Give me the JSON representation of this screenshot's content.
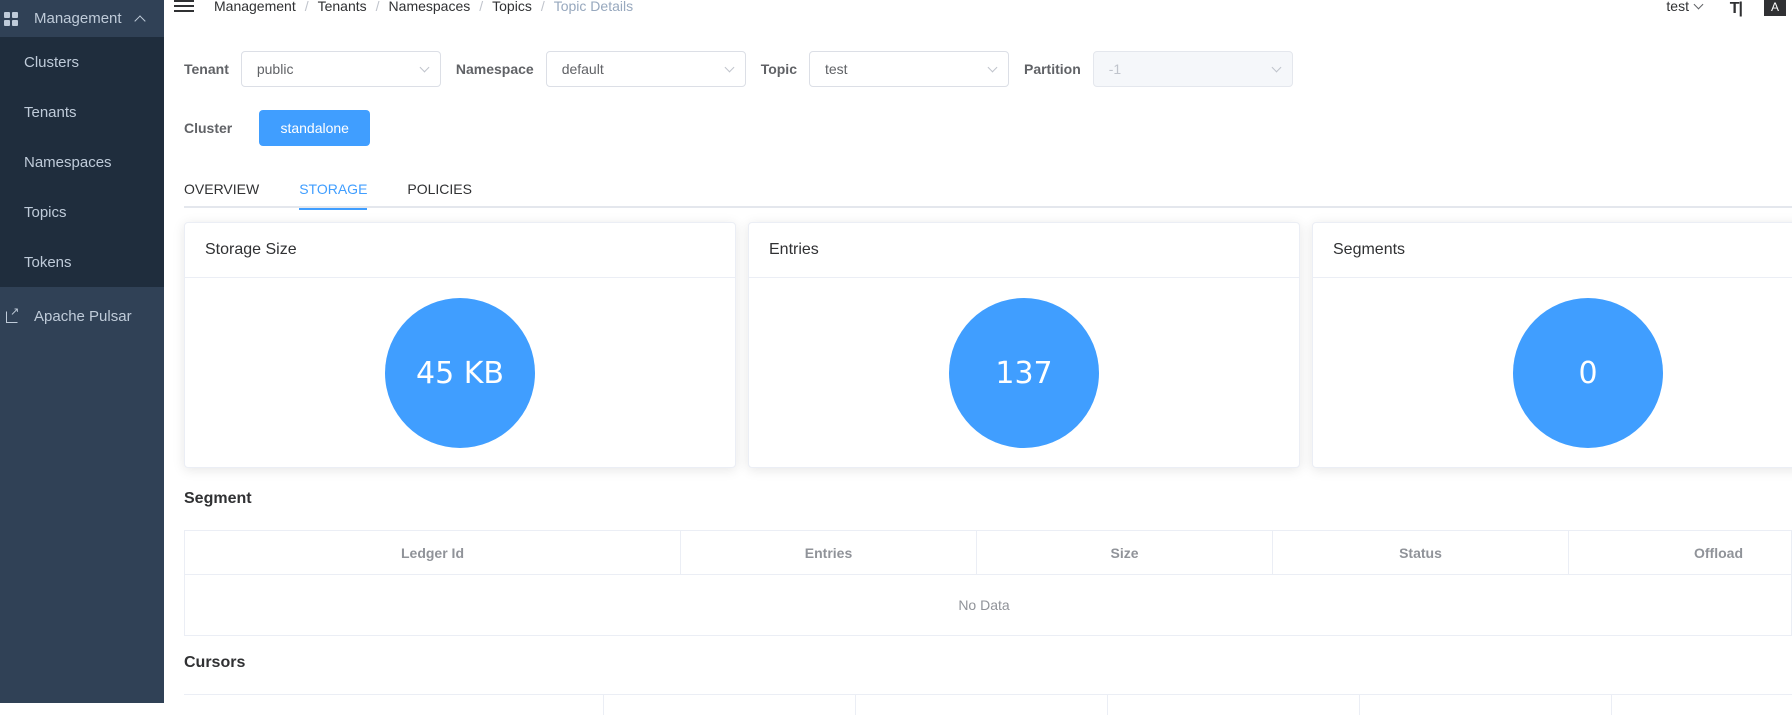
{
  "sidebar": {
    "header_label": "Management",
    "items": [
      {
        "label": "Clusters"
      },
      {
        "label": "Tenants"
      },
      {
        "label": "Namespaces"
      },
      {
        "label": "Topics"
      },
      {
        "label": "Tokens"
      }
    ],
    "external_link": "Apache Pulsar"
  },
  "breadcrumb": [
    "Management",
    "Tenants",
    "Namespaces",
    "Topics",
    "Topic Details"
  ],
  "user": {
    "name": "test"
  },
  "filters": {
    "tenant": {
      "label": "Tenant",
      "value": "public"
    },
    "namespace": {
      "label": "Namespace",
      "value": "default"
    },
    "topic": {
      "label": "Topic",
      "value": "test"
    },
    "partition": {
      "label": "Partition",
      "value": "-1"
    }
  },
  "cluster": {
    "label": "Cluster",
    "button": "standalone"
  },
  "tabs": [
    {
      "label": "OVERVIEW",
      "active": false
    },
    {
      "label": "STORAGE",
      "active": true
    },
    {
      "label": "POLICIES",
      "active": false
    }
  ],
  "cards": [
    {
      "title": "Storage Size",
      "value": "45 KB"
    },
    {
      "title": "Entries",
      "value": "137"
    },
    {
      "title": "Segments",
      "value": "0"
    }
  ],
  "segment": {
    "title": "Segment",
    "columns": [
      "Ledger Id",
      "Entries",
      "Size",
      "Status",
      "Offload"
    ],
    "empty_text": "No Data"
  },
  "cursors": {
    "title": "Cursors"
  },
  "colors": {
    "sidebar_bg": "#304156",
    "sidebar_sub_bg": "#1f2d3d",
    "primary": "#409eff"
  }
}
